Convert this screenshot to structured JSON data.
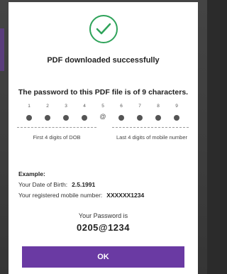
{
  "dialog": {
    "success_title": "PDF downloaded successfully",
    "heading": "The password to this PDF file is of 9 characters.",
    "slots": [
      "1",
      "2",
      "3",
      "4",
      "5",
      "6",
      "7",
      "8",
      "9"
    ],
    "at_symbol": "@",
    "left_caption": "First 4 digits of DOB",
    "right_caption": "Last 4 digits of mobile number",
    "example": {
      "label": "Example:",
      "dob_label": "Your Date of Birth:",
      "dob_value": "2.5.1991",
      "mobile_label": "Your registered mobile number:",
      "mobile_value": "XXXXXX1234"
    },
    "password_label": "Your Password is",
    "password_value": "0205@1234",
    "ok_label": "OK"
  },
  "colors": {
    "accent": "#6a3aa3",
    "success": "#2fa35a"
  },
  "icons": {
    "success": "check-circle-icon"
  }
}
